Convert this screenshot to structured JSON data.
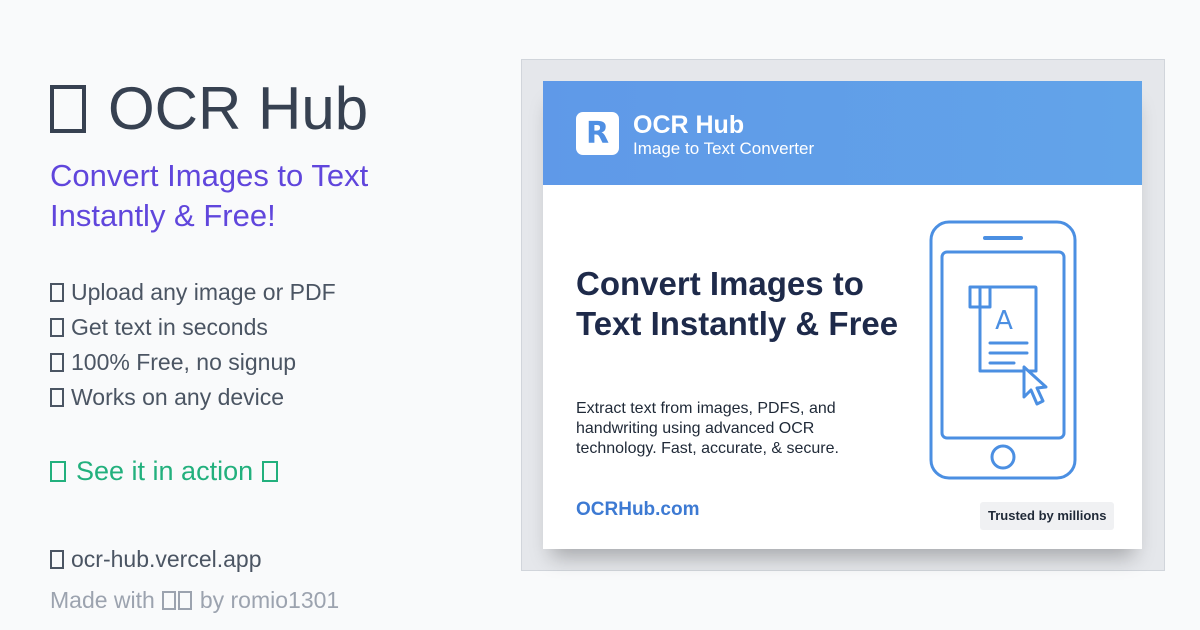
{
  "app": {
    "title": "OCR Hub",
    "tagline": "Convert Images to Text Instantly & Free!"
  },
  "features": [
    {
      "icon": "upload-icon",
      "label": "Upload any image or PDF"
    },
    {
      "icon": "lightning-icon",
      "label": "Get text in seconds"
    },
    {
      "icon": "gift-icon",
      "label": "100% Free, no signup"
    },
    {
      "icon": "device-icon",
      "label": "Works on any device"
    }
  ],
  "cta": {
    "label": "See it in action"
  },
  "footer": {
    "url": "ocr-hub.vercel.app",
    "credit_prefix": "Made with",
    "credit_suffix": "by romio1301"
  },
  "card": {
    "logo_letter": "R",
    "brand_name": "OCR Hub",
    "brand_subtitle": "Image to Text Converter",
    "headline": "Convert Images to Text Instantly & Free",
    "description": "Extract text from images, PDFS, and handwriting using advanced OCR technology. Fast, accurate, & secure.",
    "site": "OCRHub.com",
    "badge": "Trusted by millions",
    "doc_letter": "A"
  },
  "colors": {
    "page_background": "#f9fafb",
    "title": "#374151",
    "tagline": "#6046dc",
    "cta": "#22b07d",
    "muted": "#9ca3af",
    "card_header": "#5f99e8",
    "icon_blue": "#4b8fe2",
    "headline_navy": "#1e2a4a"
  }
}
